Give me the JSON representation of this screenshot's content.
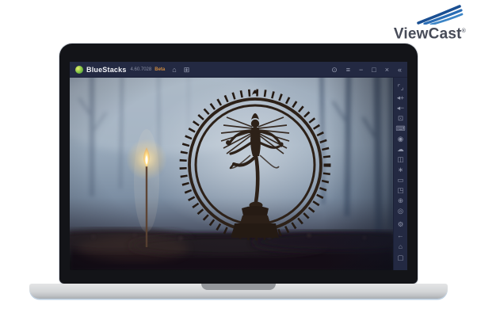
{
  "brand": {
    "name": "ViewCast",
    "mark": "®",
    "accent_blue": "#2a6db5",
    "text_color": "#474b58"
  },
  "window": {
    "app_name": "BlueStacks",
    "version": "4.60.7028",
    "beta_label": "Beta",
    "colors": {
      "titlebar": "#232942",
      "beta_orange": "#cf8a3e"
    },
    "titlebar_left_icons": [
      {
        "name": "home",
        "glyph": "⌂"
      },
      {
        "name": "multi-instance",
        "glyph": "⊞"
      }
    ],
    "controls": [
      {
        "name": "help",
        "glyph": "⊙"
      },
      {
        "name": "menu",
        "glyph": "≡"
      },
      {
        "name": "minimize",
        "glyph": "−"
      },
      {
        "name": "maximize",
        "glyph": "□"
      },
      {
        "name": "close",
        "glyph": "×"
      },
      {
        "name": "collapse-sidebar",
        "glyph": "«"
      }
    ]
  },
  "sidebar": {
    "top_items": [
      {
        "name": "fullscreen",
        "glyph": "⌜⌟"
      },
      {
        "name": "volume-up",
        "glyph": "◂+"
      },
      {
        "name": "volume-down",
        "glyph": "◂−"
      },
      {
        "name": "screenshot",
        "glyph": "⊡"
      },
      {
        "name": "keyboard-controls",
        "glyph": "⌨"
      },
      {
        "name": "record",
        "glyph": "◉"
      },
      {
        "name": "cloud-sync",
        "glyph": "☁"
      },
      {
        "name": "camera",
        "glyph": "◫"
      },
      {
        "name": "shake",
        "glyph": "∗"
      },
      {
        "name": "media-folder",
        "glyph": "▭"
      },
      {
        "name": "multi-window",
        "glyph": "◳"
      },
      {
        "name": "location",
        "glyph": "⊕"
      },
      {
        "name": "macro",
        "glyph": "◎"
      }
    ],
    "bottom_items": [
      {
        "name": "settings",
        "glyph": "⚙"
      },
      {
        "name": "back",
        "glyph": "←"
      },
      {
        "name": "home",
        "glyph": "⌂"
      },
      {
        "name": "recent-apps",
        "glyph": "▢"
      }
    ]
  }
}
